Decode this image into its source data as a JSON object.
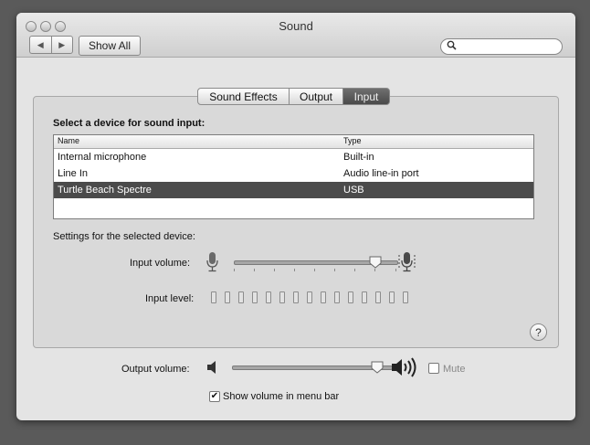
{
  "window": {
    "title": "Sound"
  },
  "toolbar": {
    "back_glyph": "◀",
    "forward_glyph": "▶",
    "show_all_label": "Show All",
    "search_placeholder": "",
    "search_icon": "search-icon"
  },
  "tabs": [
    {
      "label": "Sound Effects",
      "selected": false
    },
    {
      "label": "Output",
      "selected": false
    },
    {
      "label": "Input",
      "selected": true
    }
  ],
  "input": {
    "heading": "Select a device for sound input:",
    "columns": [
      "Name",
      "Type"
    ],
    "devices": [
      {
        "name": "Internal microphone",
        "type": "Built-in",
        "selected": false
      },
      {
        "name": "Line In",
        "type": "Audio line-in port",
        "selected": false
      },
      {
        "name": "Turtle Beach Spectre",
        "type": "USB",
        "selected": true
      }
    ],
    "settings_heading": "Settings for the selected device:",
    "volume_label": "Input volume:",
    "volume_level": 0.9,
    "level_label": "Input level:",
    "level_segments": 15,
    "level_active": 0
  },
  "output": {
    "volume_label": "Output volume:",
    "volume_level": 0.95,
    "mute_label": "Mute",
    "mute_checked": false,
    "menu_bar_label": "Show volume in menu bar",
    "menu_bar_checked": true,
    "check_glyph": "✔"
  },
  "help_glyph": "?",
  "colors": {
    "selected_row": "#4b4b4b",
    "selected_tab": "#4a4a4a",
    "window_bg": "#e4e4e4"
  }
}
